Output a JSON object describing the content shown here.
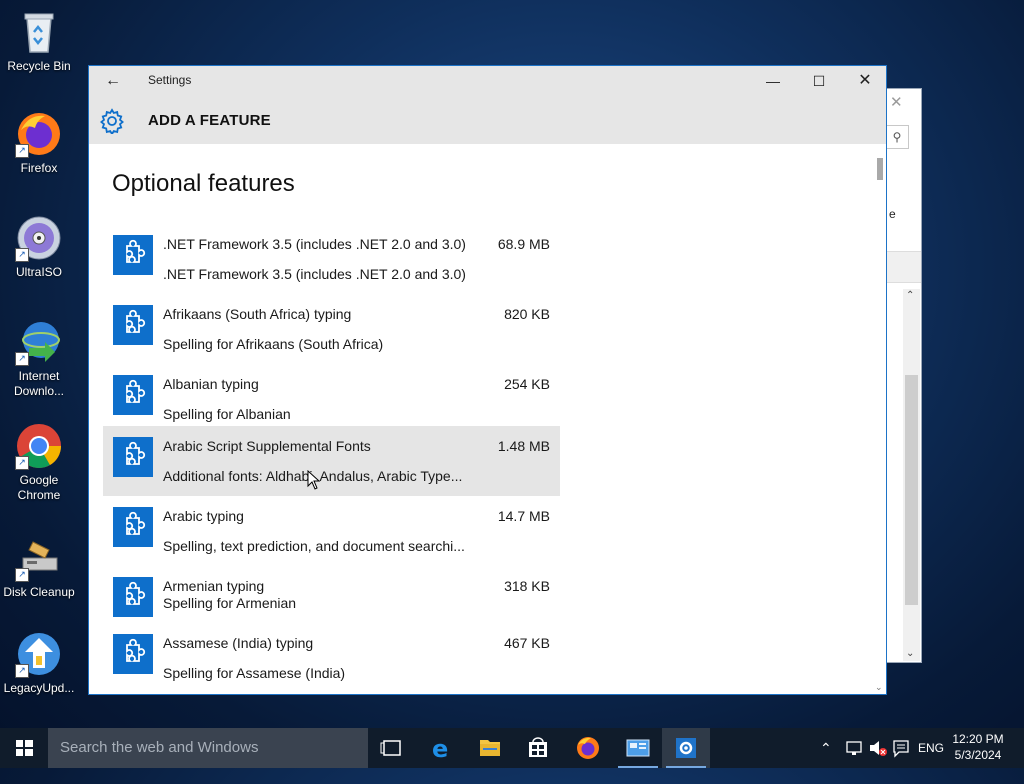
{
  "desktop": {
    "icons": [
      {
        "label": "Recycle Bin",
        "icon": "recycle-bin-icon"
      },
      {
        "label": "Firefox",
        "icon": "firefox-icon"
      },
      {
        "label": "UltraISO",
        "icon": "disc-icon"
      },
      {
        "label": "Internet Downlo...",
        "icon": "download-manager-icon"
      },
      {
        "label": "Google Chrome",
        "icon": "chrome-icon"
      },
      {
        "label": "Disk Cleanup",
        "icon": "disk-cleanup-icon"
      },
      {
        "label": "LegacyUpd...",
        "icon": "legacy-update-icon"
      }
    ]
  },
  "window": {
    "title": "Settings",
    "header_title": "ADD A FEATURE",
    "section_title": "Optional features",
    "accent_color": "#0e6fcb"
  },
  "features": [
    {
      "name": ".NET Framework 3.5 (includes .NET 2.0 and 3.0)",
      "size": "68.9 MB",
      "description": ".NET Framework 3.5 (includes .NET 2.0 and 3.0)"
    },
    {
      "name": "Afrikaans (South Africa) typing",
      "size": "820 KB",
      "description": "Spelling for Afrikaans (South Africa)"
    },
    {
      "name": "Albanian typing",
      "size": "254 KB",
      "description": "Spelling for Albanian"
    },
    {
      "name": "Arabic Script Supplemental Fonts",
      "size": "1.48 MB",
      "description": "Additional fonts: Aldhabi, Andalus, Arabic Type..."
    },
    {
      "name": "Arabic typing",
      "size": "14.7 MB",
      "description": "Spelling, text prediction, and document searchi..."
    },
    {
      "name": "Armenian typing",
      "size": "318 KB",
      "description": "Spelling for Armenian"
    },
    {
      "name": "Assamese (India) typing",
      "size": "467 KB",
      "description": "Spelling for Assamese (India)"
    }
  ],
  "taskbar": {
    "search_placeholder": "Search the web and Windows",
    "language": "ENG",
    "time": "12:20 PM",
    "date": "5/3/2024"
  }
}
